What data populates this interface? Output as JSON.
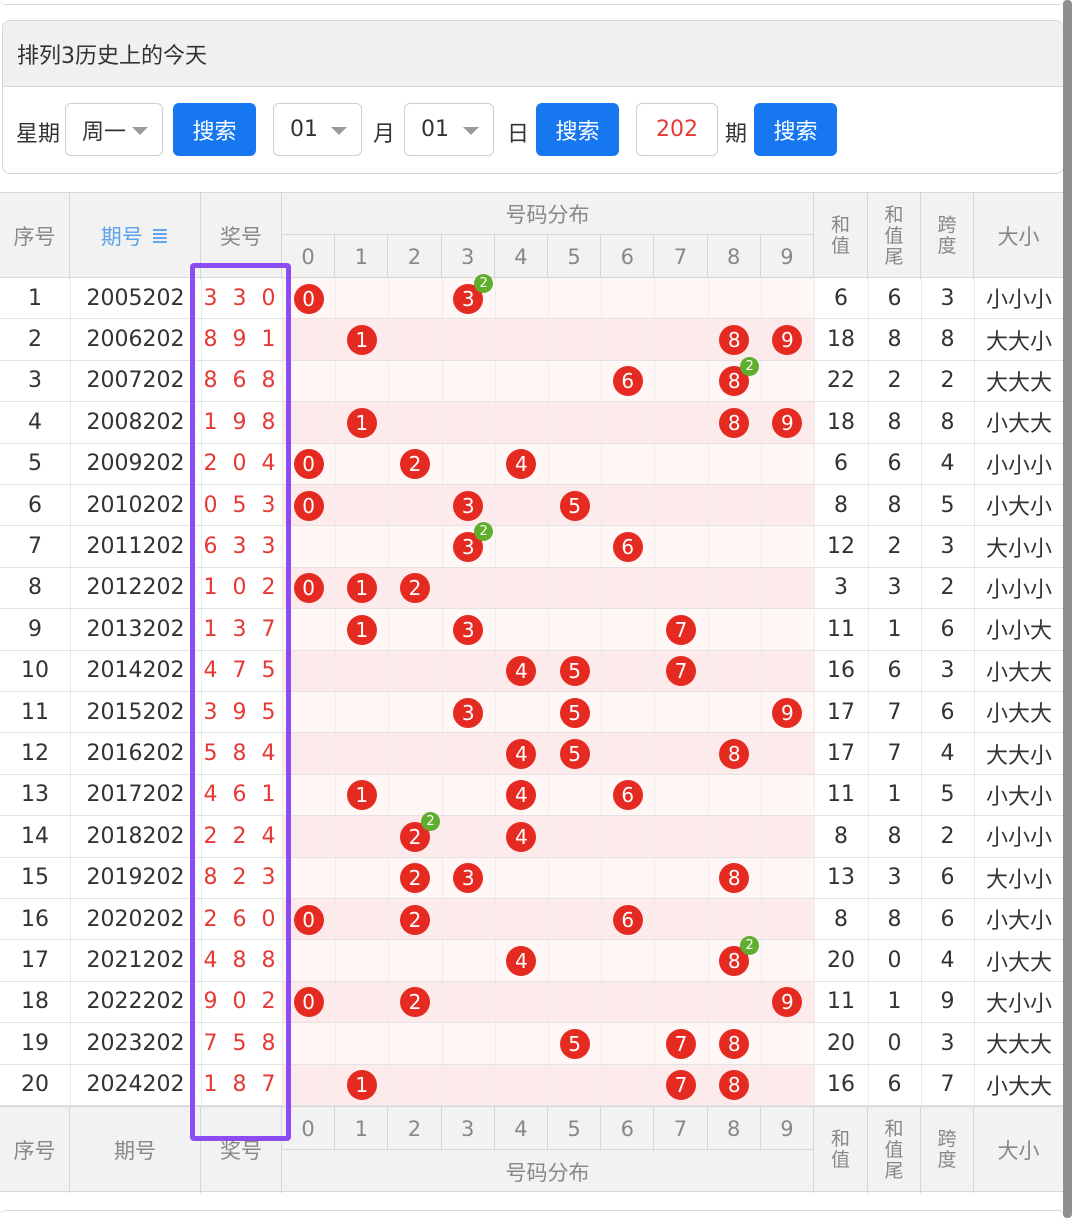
{
  "page_title": "排列3历史上的今天",
  "search": {
    "week_label": "星期",
    "week_value": "周一",
    "search_label": "搜索",
    "month_value": "01",
    "month_label": "月",
    "day_value": "01",
    "day_label": "日",
    "issue_value": "202",
    "issue_label": "期"
  },
  "header": {
    "index": "序号",
    "period": "期号",
    "period_sort_icon": "≣",
    "draw": "奖号",
    "distribution": "号码分布",
    "digits": [
      "0",
      "1",
      "2",
      "3",
      "4",
      "5",
      "6",
      "7",
      "8",
      "9"
    ],
    "sum": "和值",
    "sum_tail": "和值尾",
    "span": "跨度",
    "size": "大小"
  },
  "rows": [
    {
      "index": "1",
      "period": "2005202",
      "draw": "3 3 0",
      "sum": "6",
      "tail": "6",
      "span": "3",
      "size": "小小小",
      "balls": [
        0,
        3
      ],
      "dup": [
        3
      ]
    },
    {
      "index": "2",
      "period": "2006202",
      "draw": "8 9 1",
      "sum": "18",
      "tail": "8",
      "span": "8",
      "size": "大大小",
      "balls": [
        1,
        8,
        9
      ],
      "dup": []
    },
    {
      "index": "3",
      "period": "2007202",
      "draw": "8 6 8",
      "sum": "22",
      "tail": "2",
      "span": "2",
      "size": "大大大",
      "balls": [
        6,
        8
      ],
      "dup": [
        8
      ]
    },
    {
      "index": "4",
      "period": "2008202",
      "draw": "1 9 8",
      "sum": "18",
      "tail": "8",
      "span": "8",
      "size": "小大大",
      "balls": [
        1,
        8,
        9
      ],
      "dup": []
    },
    {
      "index": "5",
      "period": "2009202",
      "draw": "2 0 4",
      "sum": "6",
      "tail": "6",
      "span": "4",
      "size": "小小小",
      "balls": [
        0,
        2,
        4
      ],
      "dup": []
    },
    {
      "index": "6",
      "period": "2010202",
      "draw": "0 5 3",
      "sum": "8",
      "tail": "8",
      "span": "5",
      "size": "小大小",
      "balls": [
        0,
        3,
        5
      ],
      "dup": []
    },
    {
      "index": "7",
      "period": "2011202",
      "draw": "6 3 3",
      "sum": "12",
      "tail": "2",
      "span": "3",
      "size": "大小小",
      "balls": [
        3,
        6
      ],
      "dup": [
        3
      ]
    },
    {
      "index": "8",
      "period": "2012202",
      "draw": "1 0 2",
      "sum": "3",
      "tail": "3",
      "span": "2",
      "size": "小小小",
      "balls": [
        0,
        1,
        2
      ],
      "dup": []
    },
    {
      "index": "9",
      "period": "2013202",
      "draw": "1 3 7",
      "sum": "11",
      "tail": "1",
      "span": "6",
      "size": "小小大",
      "balls": [
        1,
        3,
        7
      ],
      "dup": []
    },
    {
      "index": "10",
      "period": "2014202",
      "draw": "4 7 5",
      "sum": "16",
      "tail": "6",
      "span": "3",
      "size": "小大大",
      "balls": [
        4,
        5,
        7
      ],
      "dup": []
    },
    {
      "index": "11",
      "period": "2015202",
      "draw": "3 9 5",
      "sum": "17",
      "tail": "7",
      "span": "6",
      "size": "小大大",
      "balls": [
        3,
        5,
        9
      ],
      "dup": []
    },
    {
      "index": "12",
      "period": "2016202",
      "draw": "5 8 4",
      "sum": "17",
      "tail": "7",
      "span": "4",
      "size": "大大小",
      "balls": [
        4,
        5,
        8
      ],
      "dup": []
    },
    {
      "index": "13",
      "period": "2017202",
      "draw": "4 6 1",
      "sum": "11",
      "tail": "1",
      "span": "5",
      "size": "小大小",
      "balls": [
        1,
        4,
        6
      ],
      "dup": []
    },
    {
      "index": "14",
      "period": "2018202",
      "draw": "2 2 4",
      "sum": "8",
      "tail": "8",
      "span": "2",
      "size": "小小小",
      "balls": [
        2,
        4
      ],
      "dup": [
        2
      ]
    },
    {
      "index": "15",
      "period": "2019202",
      "draw": "8 2 3",
      "sum": "13",
      "tail": "3",
      "span": "6",
      "size": "大小小",
      "balls": [
        2,
        3,
        8
      ],
      "dup": []
    },
    {
      "index": "16",
      "period": "2020202",
      "draw": "2 6 0",
      "sum": "8",
      "tail": "8",
      "span": "6",
      "size": "小大小",
      "balls": [
        0,
        2,
        6
      ],
      "dup": []
    },
    {
      "index": "17",
      "period": "2021202",
      "draw": "4 8 8",
      "sum": "20",
      "tail": "0",
      "span": "4",
      "size": "小大大",
      "balls": [
        4,
        8
      ],
      "dup": [
        8
      ]
    },
    {
      "index": "18",
      "period": "2022202",
      "draw": "9 0 2",
      "sum": "11",
      "tail": "1",
      "span": "9",
      "size": "大小小",
      "balls": [
        0,
        2,
        9
      ],
      "dup": []
    },
    {
      "index": "19",
      "period": "2023202",
      "draw": "7 5 8",
      "sum": "20",
      "tail": "0",
      "span": "3",
      "size": "大大大",
      "balls": [
        5,
        7,
        8
      ],
      "dup": []
    },
    {
      "index": "20",
      "period": "2024202",
      "draw": "1 8 7",
      "sum": "16",
      "tail": "6",
      "span": "7",
      "size": "小大大",
      "balls": [
        1,
        7,
        8
      ],
      "dup": []
    }
  ],
  "footer": {
    "index": "序号",
    "period": "期号",
    "draw": "奖号",
    "distribution": "号码分布",
    "sum": "和值",
    "sum_tail": "和值尾",
    "span": "跨度",
    "size": "大小"
  },
  "colors": {
    "ball": "#e52a22",
    "duplicate_badge": "#5fae2d",
    "button": "#1677f0",
    "highlight_box": "#8b4cf4",
    "draw_text": "#e53935"
  }
}
